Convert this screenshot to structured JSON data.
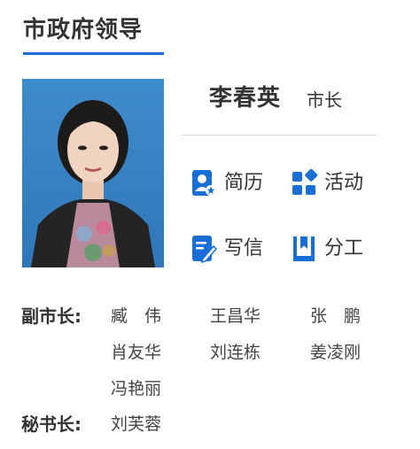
{
  "section": {
    "title": "市政府领导"
  },
  "leader": {
    "name": "李春英",
    "title": "市长"
  },
  "actions": [
    {
      "label": "简历",
      "icon": "resume-icon"
    },
    {
      "label": "活动",
      "icon": "activities-icon"
    },
    {
      "label": "写信",
      "icon": "write-letter-icon"
    },
    {
      "label": "分工",
      "icon": "division-of-work-icon"
    }
  ],
  "vice_mayors": {
    "label": "副市长:",
    "names": [
      "臧　伟",
      "王昌华",
      "张　鹏",
      "肖友华",
      "刘连栋",
      "姜凌刚",
      "冯艳丽"
    ]
  },
  "secretary_general": {
    "label": "秘书长:",
    "names": [
      "刘芙蓉"
    ]
  },
  "colors": {
    "accent": "#1a6fd6",
    "text": "#333333",
    "divider": "#dcdcdc"
  }
}
